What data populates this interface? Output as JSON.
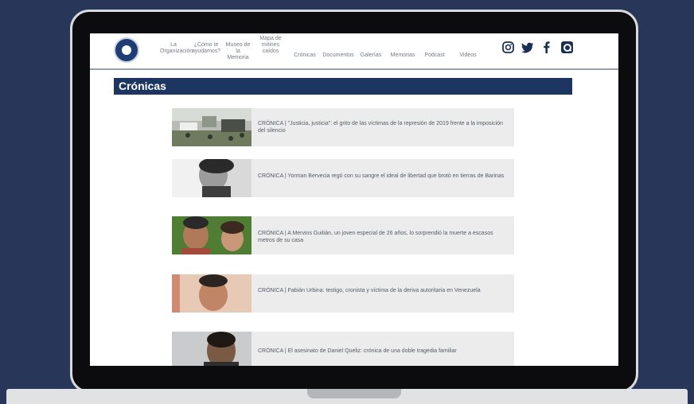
{
  "nav": {
    "items": [
      {
        "label": "La Organización"
      },
      {
        "label": "¿Cómo te ayudamos?"
      },
      {
        "label": "Museo de la Memoria"
      },
      {
        "label": "Mapa de mitines caídos"
      },
      {
        "label": "Crónicas"
      },
      {
        "label": "Documentos"
      },
      {
        "label": "Galerías"
      },
      {
        "label": "Memorias"
      },
      {
        "label": "Podcast"
      },
      {
        "label": "Videos"
      }
    ],
    "social": {
      "instagram_icon": "instagram-icon",
      "twitter_icon": "twitter-icon",
      "facebook_icon": "facebook-icon",
      "search_icon": "search-icon"
    }
  },
  "section": {
    "title": "Crónicas"
  },
  "articles": [
    {
      "title": "CRÓNICA | \"Justicia, justicia\": el grito de las víctimas de la represión de 2019 frente a la imposición del silencio"
    },
    {
      "title": "CRÓNICA | Yorman Bervecia regó con su sangre el ideal de libertad que brotó en tierras de Barinas"
    },
    {
      "title": "CRÓNICA | A Mervins Guitián, un joven especial de 26 años, lo sorprendió la muerte a escasos metros de su casa"
    },
    {
      "title": "CRÓNICA | Fabián Urbina: testigo, cronista y víctima de la deriva autoritaria en Venezuela"
    },
    {
      "title": "CRÓNICA | El asesinato de Daniel Queliz: crónica de una doble tragedia familiar"
    }
  ],
  "colors": {
    "background": "#28365a",
    "brand": "#1d3561",
    "card": "#ececec"
  }
}
